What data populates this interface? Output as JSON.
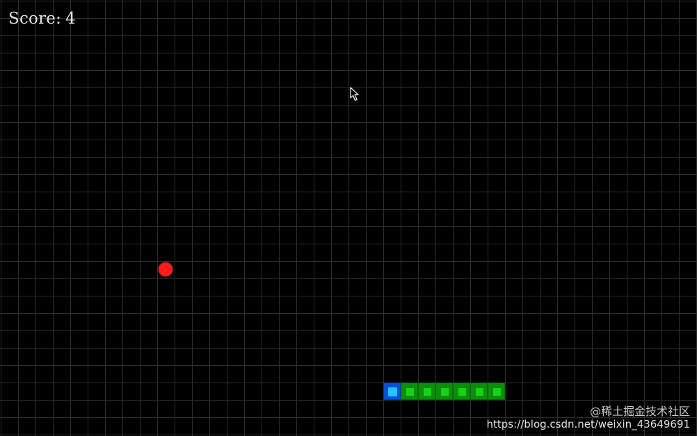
{
  "hud": {
    "score_label": "Score:",
    "score_value": "4"
  },
  "game": {
    "board": {
      "cols": 40,
      "rows": 25
    },
    "snake": {
      "direction": "left",
      "segments": [
        {
          "col": 22,
          "row": 22,
          "part": "head"
        },
        {
          "col": 23,
          "row": 22,
          "part": "body"
        },
        {
          "col": 24,
          "row": 22,
          "part": "body"
        },
        {
          "col": 25,
          "row": 22,
          "part": "body"
        },
        {
          "col": 26,
          "row": 22,
          "part": "body"
        },
        {
          "col": 27,
          "row": 22,
          "part": "body"
        },
        {
          "col": 28,
          "row": 22,
          "part": "body"
        }
      ]
    },
    "food": {
      "col": 9,
      "row": 15
    }
  },
  "colors": {
    "background": "#000000",
    "grid": "#2e2e2e",
    "snake_body": "#18d21a",
    "snake_head": "#21c4ff",
    "food": "#ff1a1a",
    "score_text": "#e6e6e6"
  },
  "icons": {
    "cursor": "mouse-pointer-icon"
  },
  "watermark": {
    "site": "@稀土掘金技术社区",
    "url": "https://blog.csdn.net/weixin_43649691"
  }
}
